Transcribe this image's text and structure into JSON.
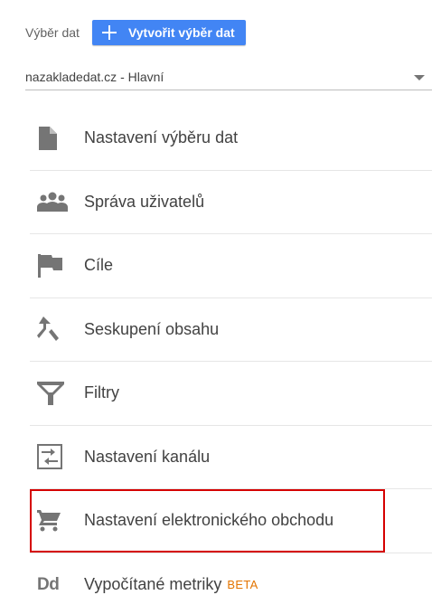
{
  "header": {
    "view_label": "Výběr dat",
    "create_button": "Vytvořit výběr dat"
  },
  "view_select": {
    "value": "nazakladedat.cz - Hlavní"
  },
  "menu": {
    "items": [
      {
        "label": "Nastavení výběru dat",
        "icon": "document-icon"
      },
      {
        "label": "Správa uživatelů",
        "icon": "people-icon"
      },
      {
        "label": "Cíle",
        "icon": "flag-icon"
      },
      {
        "label": "Seskupení obsahu",
        "icon": "merge-icon"
      },
      {
        "label": "Filtry",
        "icon": "filter-icon"
      },
      {
        "label": "Nastavení kanálu",
        "icon": "channel-settings-icon"
      },
      {
        "label": "Nastavení elektronického obchodu",
        "icon": "cart-icon"
      },
      {
        "label": "Vypočítané metriky",
        "icon": "dd-icon",
        "icon_text": "Dd",
        "badge": "BETA"
      }
    ]
  },
  "colors": {
    "accent": "#4285f4",
    "highlight": "#d50000",
    "icon": "#757575",
    "beta": "#e37400"
  }
}
